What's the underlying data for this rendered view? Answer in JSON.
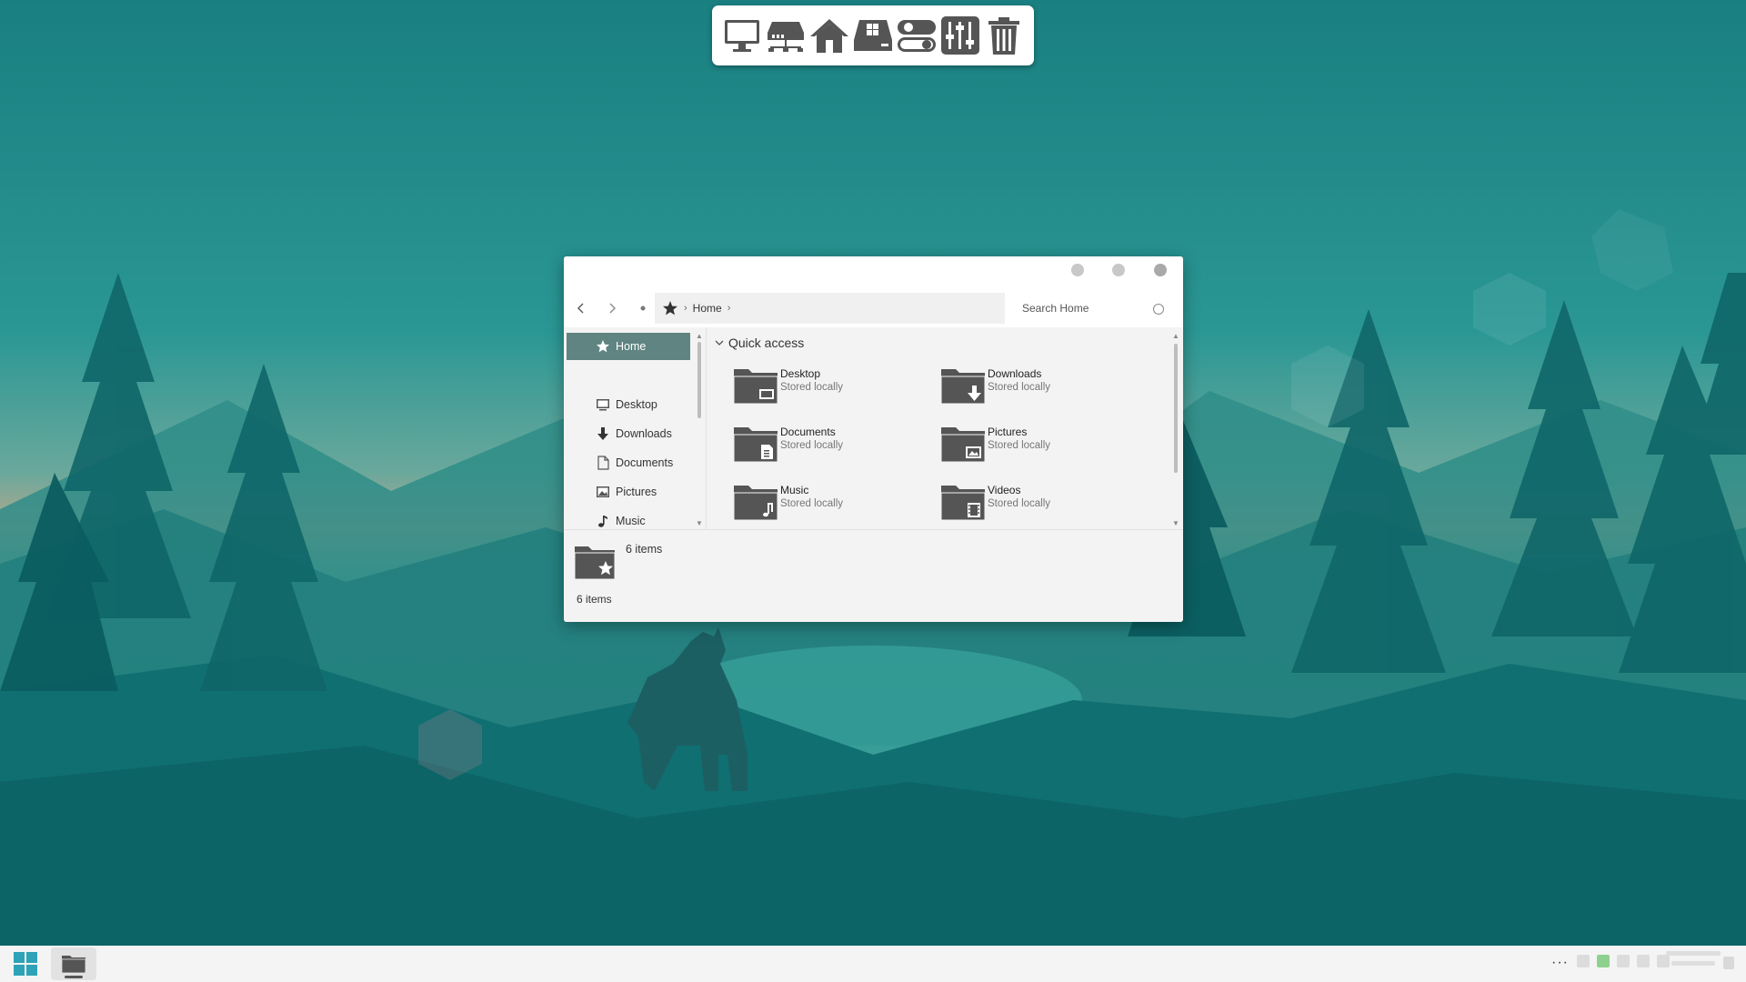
{
  "dock": {
    "items": [
      {
        "icon": "monitor-icon"
      },
      {
        "icon": "network-icon"
      },
      {
        "icon": "home-icon"
      },
      {
        "icon": "windows-drive-icon"
      },
      {
        "icon": "toggle-icon"
      },
      {
        "icon": "sliders-icon"
      },
      {
        "icon": "trash-icon"
      }
    ]
  },
  "window": {
    "address": {
      "crumb": "Home"
    },
    "search": {
      "placeholder": "Search Home"
    },
    "sidebar": {
      "items": [
        {
          "label": "Home",
          "icon": "star-icon",
          "active": true
        },
        {
          "label": "Desktop",
          "icon": "desktop-icon"
        },
        {
          "label": "Downloads",
          "icon": "download-icon"
        },
        {
          "label": "Documents",
          "icon": "document-icon"
        },
        {
          "label": "Pictures",
          "icon": "picture-icon"
        },
        {
          "label": "Music",
          "icon": "music-icon"
        }
      ]
    },
    "quick_access": {
      "title": "Quick access",
      "items": [
        {
          "name": "Desktop",
          "sub": "Stored locally",
          "icon": "desktop-folder-icon"
        },
        {
          "name": "Downloads",
          "sub": "Stored locally",
          "icon": "downloads-folder-icon"
        },
        {
          "name": "Documents",
          "sub": "Stored locally",
          "icon": "documents-folder-icon"
        },
        {
          "name": "Pictures",
          "sub": "Stored locally",
          "icon": "pictures-folder-icon"
        },
        {
          "name": "Music",
          "sub": "Stored locally",
          "icon": "music-folder-icon"
        },
        {
          "name": "Videos",
          "sub": "Stored locally",
          "icon": "videos-folder-icon"
        }
      ]
    },
    "details": {
      "count": "6 items"
    },
    "status": {
      "text": "6 items"
    }
  },
  "taskbar": {
    "tray_dots": "···"
  },
  "colors": {
    "accent": "#5f8482",
    "icon_dark": "#555555",
    "wallpaper_teal": "#1f8a8a"
  }
}
